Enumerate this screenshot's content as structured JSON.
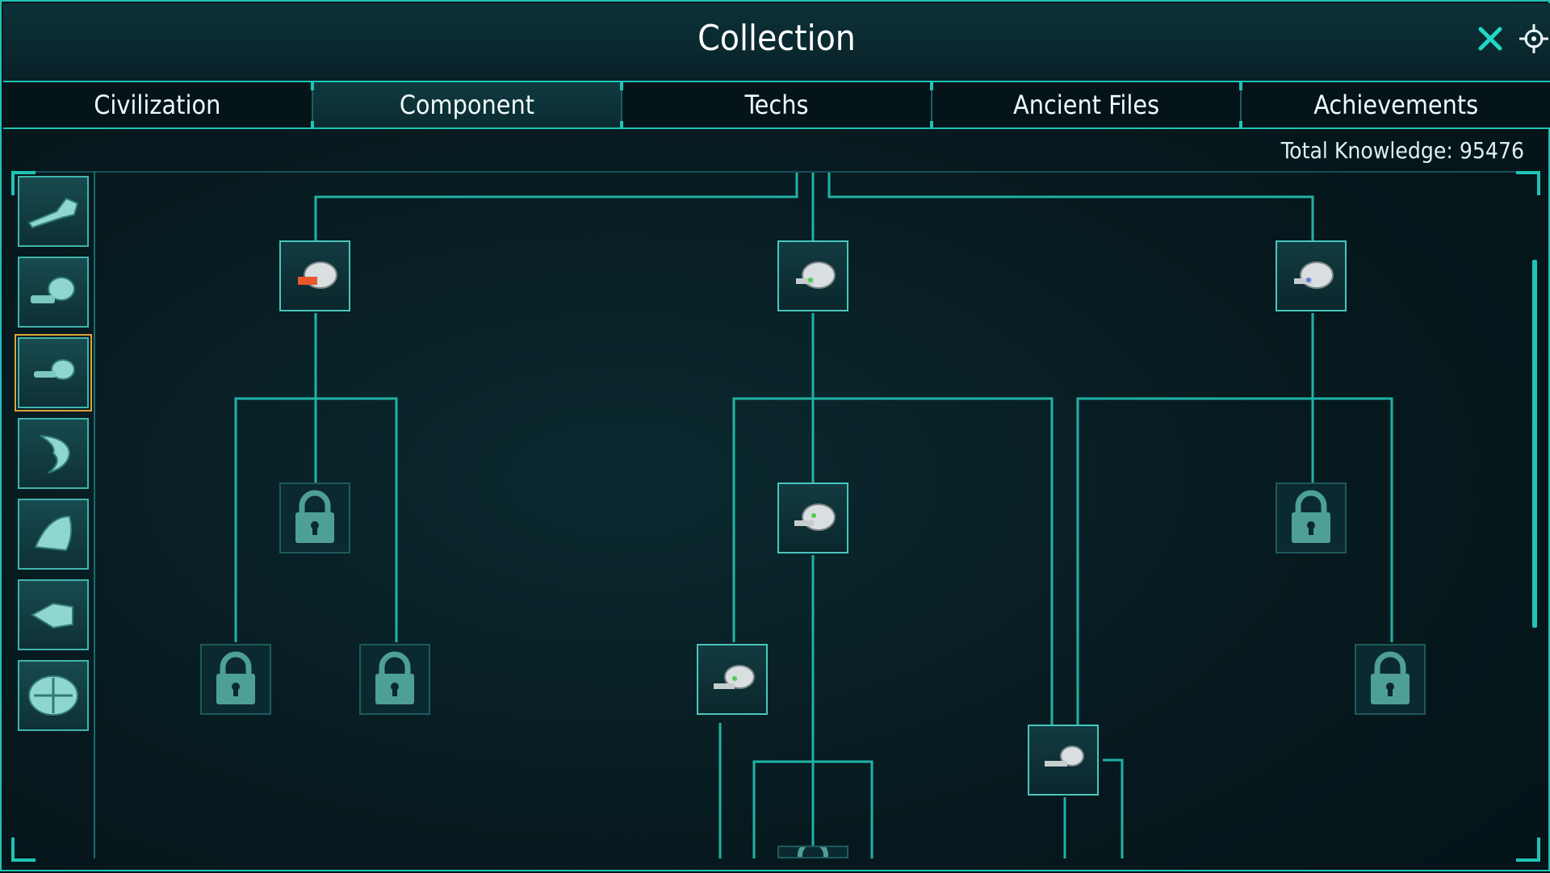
{
  "window": {
    "title": "Collection"
  },
  "header_icons": {
    "close": "close-icon",
    "target": "target-icon"
  },
  "tabs": [
    {
      "label": "Civilization",
      "active": false
    },
    {
      "label": "Component",
      "active": true
    },
    {
      "label": "Techs",
      "active": false
    },
    {
      "label": "Ancient Files",
      "active": false
    },
    {
      "label": "Achievements",
      "active": false
    }
  ],
  "knowledge": {
    "text": "Total Knowledge: 95476"
  },
  "sidebar": {
    "items": [
      {
        "icon": "blade-component-icon",
        "selected": false
      },
      {
        "icon": "drill-component-icon",
        "selected": false
      },
      {
        "icon": "cannon-component-icon",
        "selected": true
      },
      {
        "icon": "claw-component-icon",
        "selected": false
      },
      {
        "icon": "pod-component-icon",
        "selected": false
      },
      {
        "icon": "thruster-component-icon",
        "selected": false
      },
      {
        "icon": "armor-component-icon",
        "selected": false
      }
    ]
  },
  "tree": {
    "nodes": [
      {
        "id": "a",
        "state": "unlocked",
        "icon": "gun-orange-icon"
      },
      {
        "id": "b",
        "state": "unlocked",
        "icon": "gun-green-icon"
      },
      {
        "id": "c",
        "state": "unlocked",
        "icon": "gun-blue-icon"
      },
      {
        "id": "d",
        "state": "locked",
        "icon": "lock-icon"
      },
      {
        "id": "e",
        "state": "unlocked",
        "icon": "gun-green-icon"
      },
      {
        "id": "f",
        "state": "locked",
        "icon": "lock-icon"
      },
      {
        "id": "g",
        "state": "locked",
        "icon": "lock-icon"
      },
      {
        "id": "h",
        "state": "locked",
        "icon": "lock-icon"
      },
      {
        "id": "i",
        "state": "unlocked",
        "icon": "gun-green-icon"
      },
      {
        "id": "j",
        "state": "unlocked",
        "icon": "gun-grey-icon"
      },
      {
        "id": "k",
        "state": "locked",
        "icon": "lock-icon"
      },
      {
        "id": "l",
        "state": "locked",
        "icon": "lock-icon"
      }
    ]
  },
  "colors": {
    "accent": "#1fc4b5",
    "background": "#04151b",
    "selected_outline": "#e0a03a",
    "lock": "#4e9f98"
  }
}
